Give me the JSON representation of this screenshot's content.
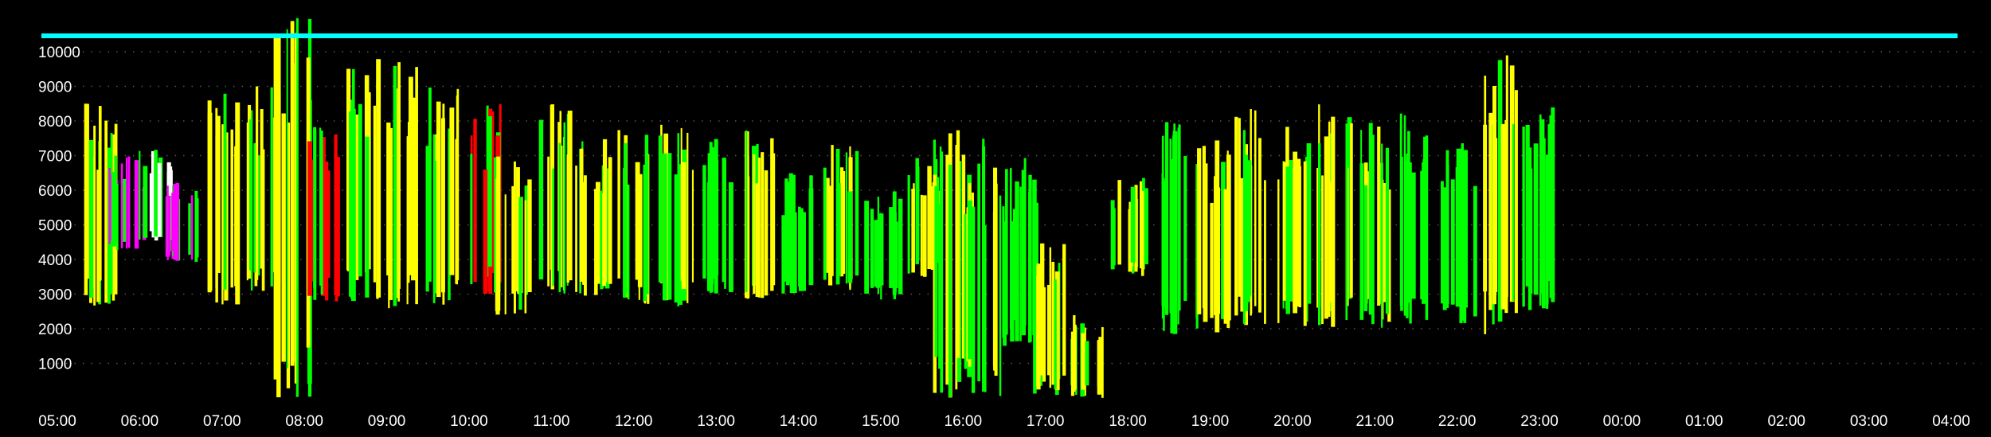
{
  "chart_data": {
    "type": "heatmap",
    "title": "",
    "xlabel": "",
    "ylabel": "",
    "x_tick_labels": [
      "05:00",
      "06:00",
      "07:00",
      "08:00",
      "09:00",
      "10:00",
      "11:00",
      "12:00",
      "13:00",
      "14:00",
      "15:00",
      "16:00",
      "17:00",
      "18:00",
      "19:00",
      "20:00",
      "21:00",
      "22:00",
      "23:00",
      "00:00",
      "01:00",
      "02:00",
      "03:00",
      "04:00"
    ],
    "y_ticks": [
      1000,
      2000,
      3000,
      4000,
      5000,
      6000,
      7000,
      8000,
      9000,
      10000
    ],
    "ylim": [
      0,
      11000
    ],
    "grid": true,
    "background": "#000000",
    "intensity_colors": {
      "low": "#00ff00",
      "medium": "#ffff00",
      "high": "#ff0000",
      "very_high": "#ff00ff",
      "max": "#ffffff"
    },
    "top_band_color": "#00ffff",
    "segments": [
      {
        "t": "05:30",
        "f0": 2600,
        "f1": 8600,
        "level": "medium"
      },
      {
        "t": "05:50",
        "f0": 4200,
        "f1": 7000,
        "level": "very_high"
      },
      {
        "t": "06:10",
        "f0": 4500,
        "f1": 7200,
        "level": "max"
      },
      {
        "t": "06:30",
        "f0": 3900,
        "f1": 6500,
        "level": "very_high"
      },
      {
        "t": "07:00",
        "f0": 2700,
        "f1": 8900,
        "level": "medium"
      },
      {
        "t": "07:30",
        "f0": 3000,
        "f1": 9000,
        "level": "medium"
      },
      {
        "t": "07:50",
        "f0": 0,
        "f1": 11000,
        "level": "medium"
      },
      {
        "t": "08:15",
        "f0": 2700,
        "f1": 8000,
        "level": "high"
      },
      {
        "t": "08:40",
        "f0": 2800,
        "f1": 9800,
        "level": "medium"
      },
      {
        "t": "09:10",
        "f0": 2500,
        "f1": 10000,
        "level": "medium"
      },
      {
        "t": "09:40",
        "f0": 2600,
        "f1": 9000,
        "level": "medium"
      },
      {
        "t": "10:10",
        "f0": 3000,
        "f1": 8500,
        "level": "high"
      },
      {
        "t": "10:30",
        "f0": 2400,
        "f1": 7000,
        "level": "medium"
      },
      {
        "t": "11:00",
        "f0": 3000,
        "f1": 8500,
        "level": "medium"
      },
      {
        "t": "11:30",
        "f0": 2800,
        "f1": 7500,
        "level": "medium"
      },
      {
        "t": "12:00",
        "f0": 2700,
        "f1": 7800,
        "level": "medium"
      },
      {
        "t": "12:30",
        "f0": 2600,
        "f1": 8000,
        "level": "medium"
      },
      {
        "t": "13:00",
        "f0": 3000,
        "f1": 7500,
        "level": "low"
      },
      {
        "t": "13:30",
        "f0": 2800,
        "f1": 8000,
        "level": "medium"
      },
      {
        "t": "14:00",
        "f0": 3000,
        "f1": 6500,
        "level": "low"
      },
      {
        "t": "14:30",
        "f0": 3000,
        "f1": 7500,
        "level": "medium"
      },
      {
        "t": "15:00",
        "f0": 2800,
        "f1": 6000,
        "level": "low"
      },
      {
        "t": "15:30",
        "f0": 3500,
        "f1": 7000,
        "level": "medium"
      },
      {
        "t": "15:50",
        "f0": 0,
        "f1": 8000,
        "level": "medium"
      },
      {
        "t": "16:15",
        "f0": 0,
        "f1": 7500,
        "level": "medium"
      },
      {
        "t": "16:40",
        "f0": 1500,
        "f1": 7000,
        "level": "low"
      },
      {
        "t": "17:00",
        "f0": 0,
        "f1": 4500,
        "level": "medium"
      },
      {
        "t": "17:30",
        "f0": 0,
        "f1": 2500,
        "level": "medium"
      },
      {
        "t": "18:00",
        "f0": 3500,
        "f1": 6500,
        "level": "medium"
      },
      {
        "t": "18:30",
        "f0": 1800,
        "f1": 8500,
        "level": "low"
      },
      {
        "t": "19:00",
        "f0": 1800,
        "f1": 7500,
        "level": "medium"
      },
      {
        "t": "19:30",
        "f0": 2000,
        "f1": 8500,
        "level": "medium"
      },
      {
        "t": "20:00",
        "f0": 2000,
        "f1": 8000,
        "level": "medium"
      },
      {
        "t": "20:30",
        "f0": 2000,
        "f1": 8500,
        "level": "medium"
      },
      {
        "t": "21:00",
        "f0": 2000,
        "f1": 8000,
        "level": "medium"
      },
      {
        "t": "21:30",
        "f0": 2000,
        "f1": 8500,
        "level": "low"
      },
      {
        "t": "22:00",
        "f0": 2000,
        "f1": 7500,
        "level": "low"
      },
      {
        "t": "22:30",
        "f0": 1800,
        "f1": 10500,
        "level": "medium"
      },
      {
        "t": "23:00",
        "f0": 2500,
        "f1": 8500,
        "level": "low"
      }
    ]
  }
}
